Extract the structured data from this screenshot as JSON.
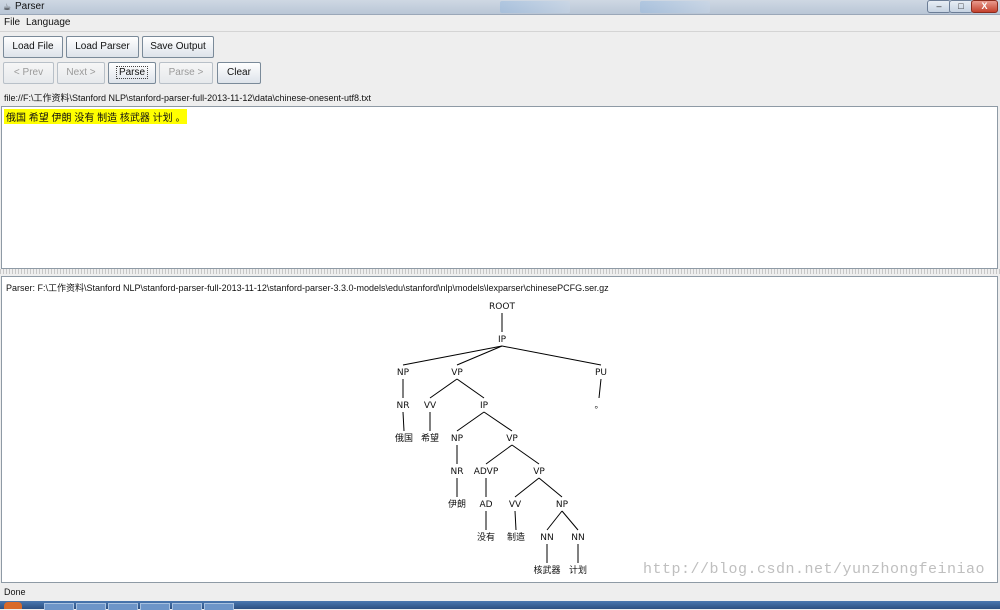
{
  "window": {
    "title": "Parser",
    "app_icon": "java-cup-icon",
    "controls": {
      "minimize": "–",
      "maximize": "□",
      "close": "X"
    }
  },
  "menu": [
    "File",
    "Language"
  ],
  "toolbar": {
    "load_file": "Load File",
    "load_parser": "Load Parser",
    "save_output": "Save Output",
    "prev": "< Prev",
    "next": "Next >",
    "parse": "Parse",
    "parse_forward": "Parse >",
    "clear": "Clear"
  },
  "file_path": "file://F:\\工作资料\\Stanford NLP\\stanford-parser-full-2013-11-12\\data\\chinese-onesent-utf8.txt",
  "input_text": "俄国 希望 伊朗 没有 制造 核武器 计划 。",
  "parser_path": "Parser: F:\\工作资料\\Stanford NLP\\stanford-parser-full-2013-11-12\\stanford-parser-3.3.0-models\\edu\\stanford\\nlp\\models\\lexparser\\chinesePCFG.ser.gz",
  "tree": {
    "nodes": [
      {
        "id": "root",
        "label": "ROOT",
        "parent": null
      },
      {
        "id": "ip1",
        "label": "IP",
        "parent": "root"
      },
      {
        "id": "np1",
        "label": "NP",
        "parent": "ip1"
      },
      {
        "id": "vp1",
        "label": "VP",
        "parent": "ip1"
      },
      {
        "id": "pu",
        "label": "PU",
        "parent": "ip1"
      },
      {
        "id": "nr1",
        "label": "NR",
        "parent": "np1"
      },
      {
        "id": "vv1",
        "label": "VV",
        "parent": "vp1"
      },
      {
        "id": "ip2",
        "label": "IP",
        "parent": "vp1"
      },
      {
        "id": "w_pu",
        "label": "。",
        "parent": "pu"
      },
      {
        "id": "w_eguo",
        "label": "俄国",
        "parent": "nr1"
      },
      {
        "id": "w_xiwang",
        "label": "希望",
        "parent": "vv1"
      },
      {
        "id": "np2",
        "label": "NP",
        "parent": "ip2"
      },
      {
        "id": "vp2",
        "label": "VP",
        "parent": "ip2"
      },
      {
        "id": "nr2",
        "label": "NR",
        "parent": "np2"
      },
      {
        "id": "advp",
        "label": "ADVP",
        "parent": "vp2"
      },
      {
        "id": "vp3",
        "label": "VP",
        "parent": "vp2"
      },
      {
        "id": "w_yilang",
        "label": "伊朗",
        "parent": "nr2"
      },
      {
        "id": "ad",
        "label": "AD",
        "parent": "advp"
      },
      {
        "id": "vv2",
        "label": "VV",
        "parent": "vp3"
      },
      {
        "id": "np3",
        "label": "NP",
        "parent": "vp3"
      },
      {
        "id": "w_meiyou",
        "label": "没有",
        "parent": "ad"
      },
      {
        "id": "w_zhizao",
        "label": "制造",
        "parent": "vv2"
      },
      {
        "id": "nn1",
        "label": "NN",
        "parent": "np3"
      },
      {
        "id": "nn2",
        "label": "NN",
        "parent": "np3"
      },
      {
        "id": "w_hewuqi",
        "label": "核武器",
        "parent": "nn1"
      },
      {
        "id": "w_jihua",
        "label": "计划",
        "parent": "nn2"
      }
    ]
  },
  "watermark": "http://blog.csdn.net/yunzhongfeiniao",
  "status": "Done"
}
